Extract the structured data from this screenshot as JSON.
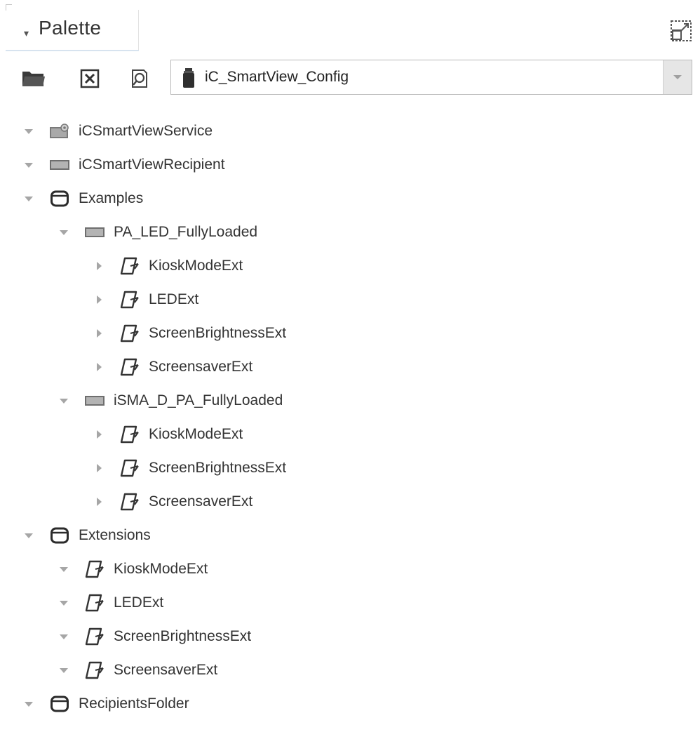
{
  "palette": {
    "title": "Palette",
    "maximize_icon": "maximize-icon"
  },
  "toolbar": {
    "open_icon": "folder-open-icon",
    "close_icon": "close-box-icon",
    "find_icon": "find-icon",
    "module_selected": "iC_SmartView_Config",
    "module_icon": "jar-icon",
    "dropdown_icon": "chevron-down-icon"
  },
  "tree": {
    "rows": [
      {
        "label": "iCSmartViewService",
        "level": 0,
        "icon": "service-icon",
        "expander": "expanded"
      },
      {
        "label": "iCSmartViewRecipient",
        "level": 0,
        "icon": "component-icon",
        "expander": "expanded"
      },
      {
        "label": "Examples",
        "level": 0,
        "icon": "folder-icon",
        "expander": "expanded"
      },
      {
        "label": "PA_LED_FullyLoaded",
        "level": 1,
        "icon": "component-icon",
        "expander": "expanded"
      },
      {
        "label": "KioskModeExt",
        "level": 2,
        "icon": "extension-icon",
        "expander": "collapsed"
      },
      {
        "label": "LEDExt",
        "level": 2,
        "icon": "extension-icon",
        "expander": "collapsed"
      },
      {
        "label": "ScreenBrightnessExt",
        "level": 2,
        "icon": "extension-icon",
        "expander": "collapsed"
      },
      {
        "label": "ScreensaverExt",
        "level": 2,
        "icon": "extension-icon",
        "expander": "collapsed"
      },
      {
        "label": "iSMA_D_PA_FullyLoaded",
        "level": 1,
        "icon": "component-icon",
        "expander": "expanded"
      },
      {
        "label": "KioskModeExt",
        "level": 2,
        "icon": "extension-icon",
        "expander": "collapsed"
      },
      {
        "label": "ScreenBrightnessExt",
        "level": 2,
        "icon": "extension-icon",
        "expander": "collapsed"
      },
      {
        "label": "ScreensaverExt",
        "level": 2,
        "icon": "extension-icon",
        "expander": "collapsed"
      },
      {
        "label": "Extensions",
        "level": 0,
        "icon": "folder-icon",
        "expander": "expanded"
      },
      {
        "label": "KioskModeExt",
        "level": 1,
        "icon": "extension-icon",
        "expander": "expanded"
      },
      {
        "label": "LEDExt",
        "level": 1,
        "icon": "extension-icon",
        "expander": "expanded"
      },
      {
        "label": "ScreenBrightnessExt",
        "level": 1,
        "icon": "extension-icon",
        "expander": "expanded"
      },
      {
        "label": "ScreensaverExt",
        "level": 1,
        "icon": "extension-icon",
        "expander": "expanded"
      },
      {
        "label": "RecipientsFolder",
        "level": 0,
        "icon": "folder-icon",
        "expander": "expanded"
      }
    ]
  }
}
